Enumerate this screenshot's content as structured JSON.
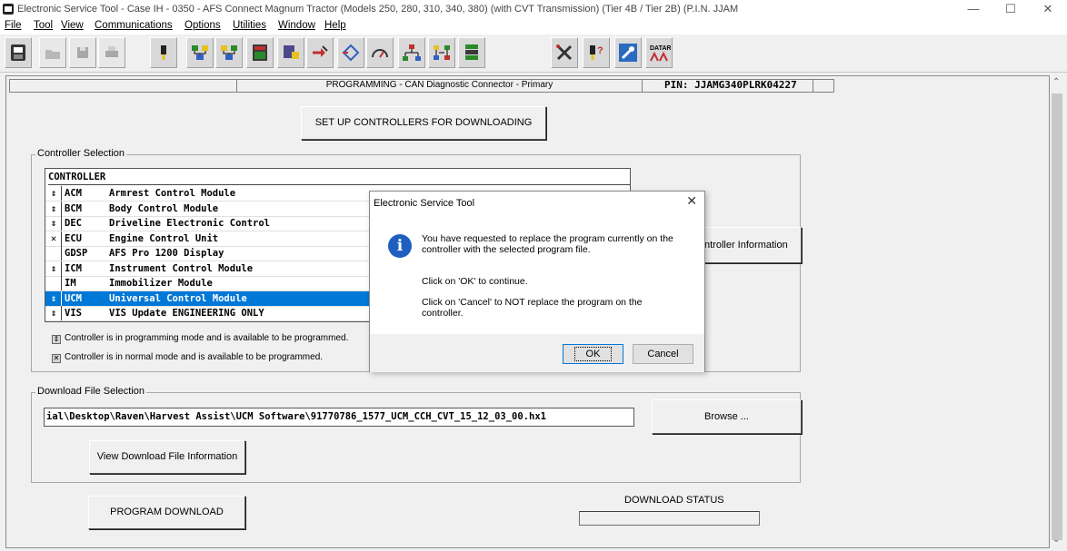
{
  "window": {
    "title": "Electronic Service Tool - Case IH - 0350 - AFS Connect Magnum Tractor (Models 250, 280, 310, 340, 380) (with CVT Transmission) (Tier 4B / Tier 2B) (P.I.N. JJAM",
    "minimize": "—",
    "maximize": "☐",
    "close": "✕"
  },
  "menu": [
    "File",
    "Tool",
    "View",
    "Communications",
    "Options",
    "Utilities",
    "Window",
    "Help"
  ],
  "header": {
    "programming": "PROGRAMMING  -  CAN Diagnostic Connector - Primary",
    "pin": "PIN: JJAMG340PLRK04227"
  },
  "buttons": {
    "setup": "SET UP CONTROLLERS FOR DOWNLOADING",
    "controller_info": "ntroller Information",
    "browse": "Browse ...",
    "view_download": "View Download File Information",
    "program_download": "PROGRAM DOWNLOAD"
  },
  "controller_selection": {
    "legend": "Controller Selection",
    "header": "CONTROLLER",
    "rows": [
      {
        "status": "⇕",
        "code": "ACM",
        "name": "Armrest Control Module",
        "selected": false
      },
      {
        "status": "⇕",
        "code": "BCM",
        "name": "Body Control Module",
        "selected": false
      },
      {
        "status": "⇕",
        "code": "DEC",
        "name": "Driveline Electronic Control",
        "selected": false
      },
      {
        "status": "✕",
        "code": "ECU",
        "name": "Engine Control Unit",
        "selected": false
      },
      {
        "status": "",
        "code": "GDSP",
        "name": "AFS Pro 1200 Display",
        "selected": false
      },
      {
        "status": "⇕",
        "code": "ICM",
        "name": "Instrument Control Module",
        "selected": false
      },
      {
        "status": "",
        "code": "IM",
        "name": "Immobilizer Module",
        "selected": false
      },
      {
        "status": "⇕",
        "code": "UCM",
        "name": "Universal Control Module",
        "selected": true
      },
      {
        "status": "⇕",
        "code": "VIS",
        "name": "VIS Update ENGINEERING ONLY",
        "selected": false
      }
    ],
    "note_programming": "Controller is in programming mode and is available to be programmed.",
    "note_normal": "Controller is in normal mode and is available to be programmed."
  },
  "download_file": {
    "legend": "Download File Selection",
    "path": "ial\\Desktop\\Raven\\Harvest Assist\\UCM Software\\91770786_1577_UCM_CCH_CVT_15_12_03_00.hx1"
  },
  "download_status": {
    "label": "DOWNLOAD STATUS",
    "value": ""
  },
  "dialog": {
    "title": "Electronic Service Tool",
    "close": "✕",
    "message1": "You have requested to replace the program currently on the controller with the selected program file.",
    "message2": "Click on 'OK' to continue.",
    "message3": "Click on 'Cancel' to NOT replace the program on the controller.",
    "ok": "OK",
    "cancel": "Cancel"
  },
  "toolbar": {
    "icons": [
      "est-icon",
      "open-folder-icon",
      "save-icon",
      "print-icon",
      "connector-icon",
      "network-icon",
      "network-alt-icon",
      "module-icon",
      "module-config-icon",
      "wrench-arrow-icon",
      "diamond-arrow-icon",
      "gauge-icon",
      "tree-network-icon",
      "controllers-tree-icon",
      "tools-icon",
      "connector-help-icon",
      "wrench-settings-icon",
      "datar-icon"
    ],
    "datar_label": "DATAR"
  }
}
